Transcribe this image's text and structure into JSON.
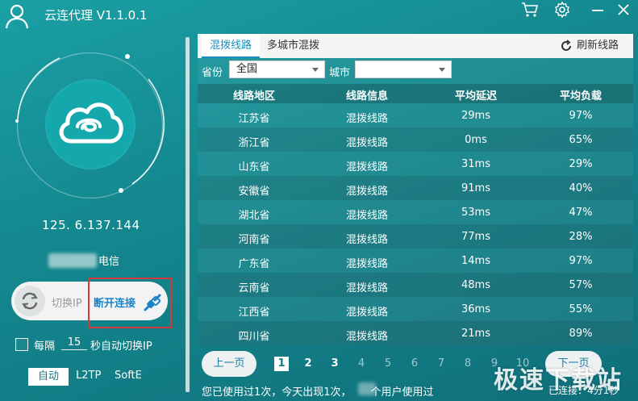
{
  "app": {
    "title": "云连代理 V1.1.0.1"
  },
  "connection": {
    "ip": "125.  6.137.144",
    "isp": "电信"
  },
  "controls": {
    "switch_ip_label": "切换IP",
    "disconnect_label": "断开连接",
    "auto_switch": {
      "checked": false,
      "prefix": "每隔",
      "interval": "15",
      "suffix": "秒自动切换IP"
    }
  },
  "modes": {
    "auto": "自动",
    "l2tp": "L2TP",
    "softe": "SoftE",
    "selected": "自动"
  },
  "tabs": {
    "active": "混拨线路",
    "other": "多城市混拨",
    "refresh": "刷新线路"
  },
  "filters": {
    "province_label": "省份",
    "province_value": "全国",
    "city_label": "城市",
    "city_value": ""
  },
  "table": {
    "headers": [
      "线路地区",
      "线路信息",
      "平均延迟",
      "平均负载"
    ],
    "rows": [
      [
        "江苏省",
        "混拨线路",
        "29ms",
        "97%"
      ],
      [
        "浙江省",
        "混拨线路",
        "0ms",
        "65%"
      ],
      [
        "山东省",
        "混拨线路",
        "31ms",
        "29%"
      ],
      [
        "安徽省",
        "混拨线路",
        "91ms",
        "40%"
      ],
      [
        "湖北省",
        "混拨线路",
        "53ms",
        "47%"
      ],
      [
        "河南省",
        "混拨线路",
        "77ms",
        "28%"
      ],
      [
        "广东省",
        "混拨线路",
        "14ms",
        "97%"
      ],
      [
        "云南省",
        "混拨线路",
        "48ms",
        "57%"
      ],
      [
        "江西省",
        "混拨线路",
        "36ms",
        "55%"
      ],
      [
        "四川省",
        "混拨线路",
        "21ms",
        "89%"
      ]
    ]
  },
  "pagination": {
    "prev": "上一页",
    "next": "下一页",
    "pages": [
      "1",
      "2",
      "3",
      "4",
      "5",
      "6",
      "7",
      "8",
      "9",
      "10"
    ],
    "current": "1"
  },
  "footer": {
    "usage_left": "您已使用过1次，今天出现1次，",
    "usage_right": "个用户使用过",
    "status": "已连接：4分1秒"
  },
  "watermark": "极速下载站",
  "colors": {
    "accent": "#1a8fb9",
    "highlight_box": "#d33b3b"
  }
}
